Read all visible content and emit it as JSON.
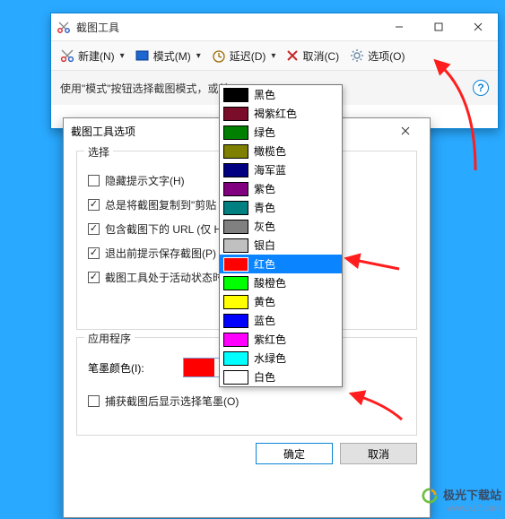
{
  "snip_window": {
    "title": "截图工具",
    "toolbar": {
      "new_label": "新建(N)",
      "mode_label": "模式(M)",
      "delay_label": "延迟(D)",
      "cancel_label": "取消(C)",
      "options_label": "选项(O)"
    },
    "hint": "使用\"模式\"按钮选择截图模式，或单"
  },
  "options_dialog": {
    "title": "截图工具选项",
    "group_select": {
      "legend": "选择",
      "hide_hint": "隐藏提示文字(H)",
      "copy_clip": "总是将截图复制到\"剪贴",
      "include_url": "包含截图下的 URL (仅 H",
      "prompt_save": "退出前提示保存截图(P)",
      "active_state": "截图工具处于活动状态时"
    },
    "group_app": {
      "legend": "应用程序",
      "ink_color_label": "笔墨颜色(I):",
      "ink_color_value": "红色",
      "capture_ink": "捕获截图后显示选择笔墨(O)"
    },
    "buttons": {
      "ok": "确定",
      "cancel": "取消"
    }
  },
  "color_list": [
    {
      "name": "黑色",
      "hex": "#000000"
    },
    {
      "name": "褐紫红色",
      "hex": "#7a0e2a"
    },
    {
      "name": "绿色",
      "hex": "#008000"
    },
    {
      "name": "橄榄色",
      "hex": "#808000"
    },
    {
      "name": "海军蓝",
      "hex": "#000080"
    },
    {
      "name": "紫色",
      "hex": "#800080"
    },
    {
      "name": "青色",
      "hex": "#008080"
    },
    {
      "name": "灰色",
      "hex": "#808080"
    },
    {
      "name": "银白",
      "hex": "#c0c0c0"
    },
    {
      "name": "红色",
      "hex": "#ff0000",
      "selected": true
    },
    {
      "name": "酸橙色",
      "hex": "#00ff00"
    },
    {
      "name": "黄色",
      "hex": "#ffff00"
    },
    {
      "name": "蓝色",
      "hex": "#0000ff"
    },
    {
      "name": "紫红色",
      "hex": "#ff00ff"
    },
    {
      "name": "水绿色",
      "hex": "#00ffff"
    },
    {
      "name": "白色",
      "hex": "#ffffff"
    }
  ],
  "watermark": {
    "title": "极光下载站",
    "url": "www.xz7.com"
  }
}
